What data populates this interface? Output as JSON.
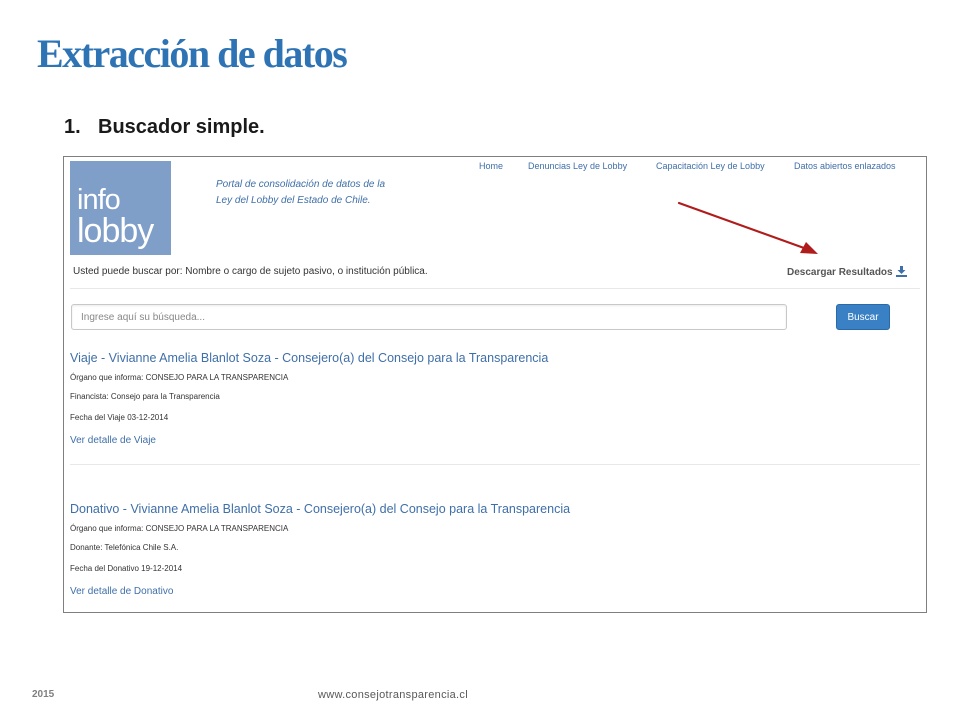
{
  "slide": {
    "title": "Extracción de datos",
    "subtitle_number": "1.",
    "subtitle_text": "Buscador simple."
  },
  "site": {
    "logo_line1": "info",
    "logo_line2": "lobby",
    "tagline_line1": "Portal de consolidación de datos de la",
    "tagline_line2": "Ley del Lobby del Estado de Chile.",
    "nav": [
      {
        "label": "Home"
      },
      {
        "label": "Denuncias Ley de Lobby"
      },
      {
        "label": "Capacitación Ley de Lobby"
      },
      {
        "label": "Datos abiertos enlazados"
      }
    ],
    "search_hint": "Usted puede buscar por: Nombre o cargo de sujeto pasivo, o institución pública.",
    "download_label": "Descargar Resultados",
    "search_placeholder": "Ingrese aquí su búsqueda...",
    "search_button": "Buscar",
    "results": [
      {
        "title": "Viaje - Vivianne Amelia Blanlot Soza - Consejero(a) del Consejo para la Transparencia",
        "organo": "Órgano que informa: CONSEJO PARA LA TRANSPARENCIA",
        "detail": "Financista: Consejo para la Transparencia",
        "fecha": "Fecha del Viaje 03-12-2014",
        "link": "Ver detalle de Viaje"
      },
      {
        "title": "Donativo - Vivianne Amelia Blanlot Soza - Consejero(a) del Consejo para la Transparencia",
        "organo": "Órgano que informa: CONSEJO PARA LA TRANSPARENCIA",
        "detail": "Donante: Telefónica Chile S.A.",
        "fecha": "Fecha del Donativo 19-12-2014",
        "link": "Ver detalle de Donativo"
      }
    ]
  },
  "footer": {
    "year": "2015",
    "url": "www.consejotransparencia.cl"
  },
  "colors": {
    "title_blue": "#2e74b5",
    "link_blue": "#3f6fa8",
    "logo_bg": "#7f9ec8",
    "button_blue": "#3a80c4",
    "arrow_red": "#b01c1c"
  },
  "icons": {
    "download": "download-icon",
    "arrow": "red-arrow-annotation"
  }
}
